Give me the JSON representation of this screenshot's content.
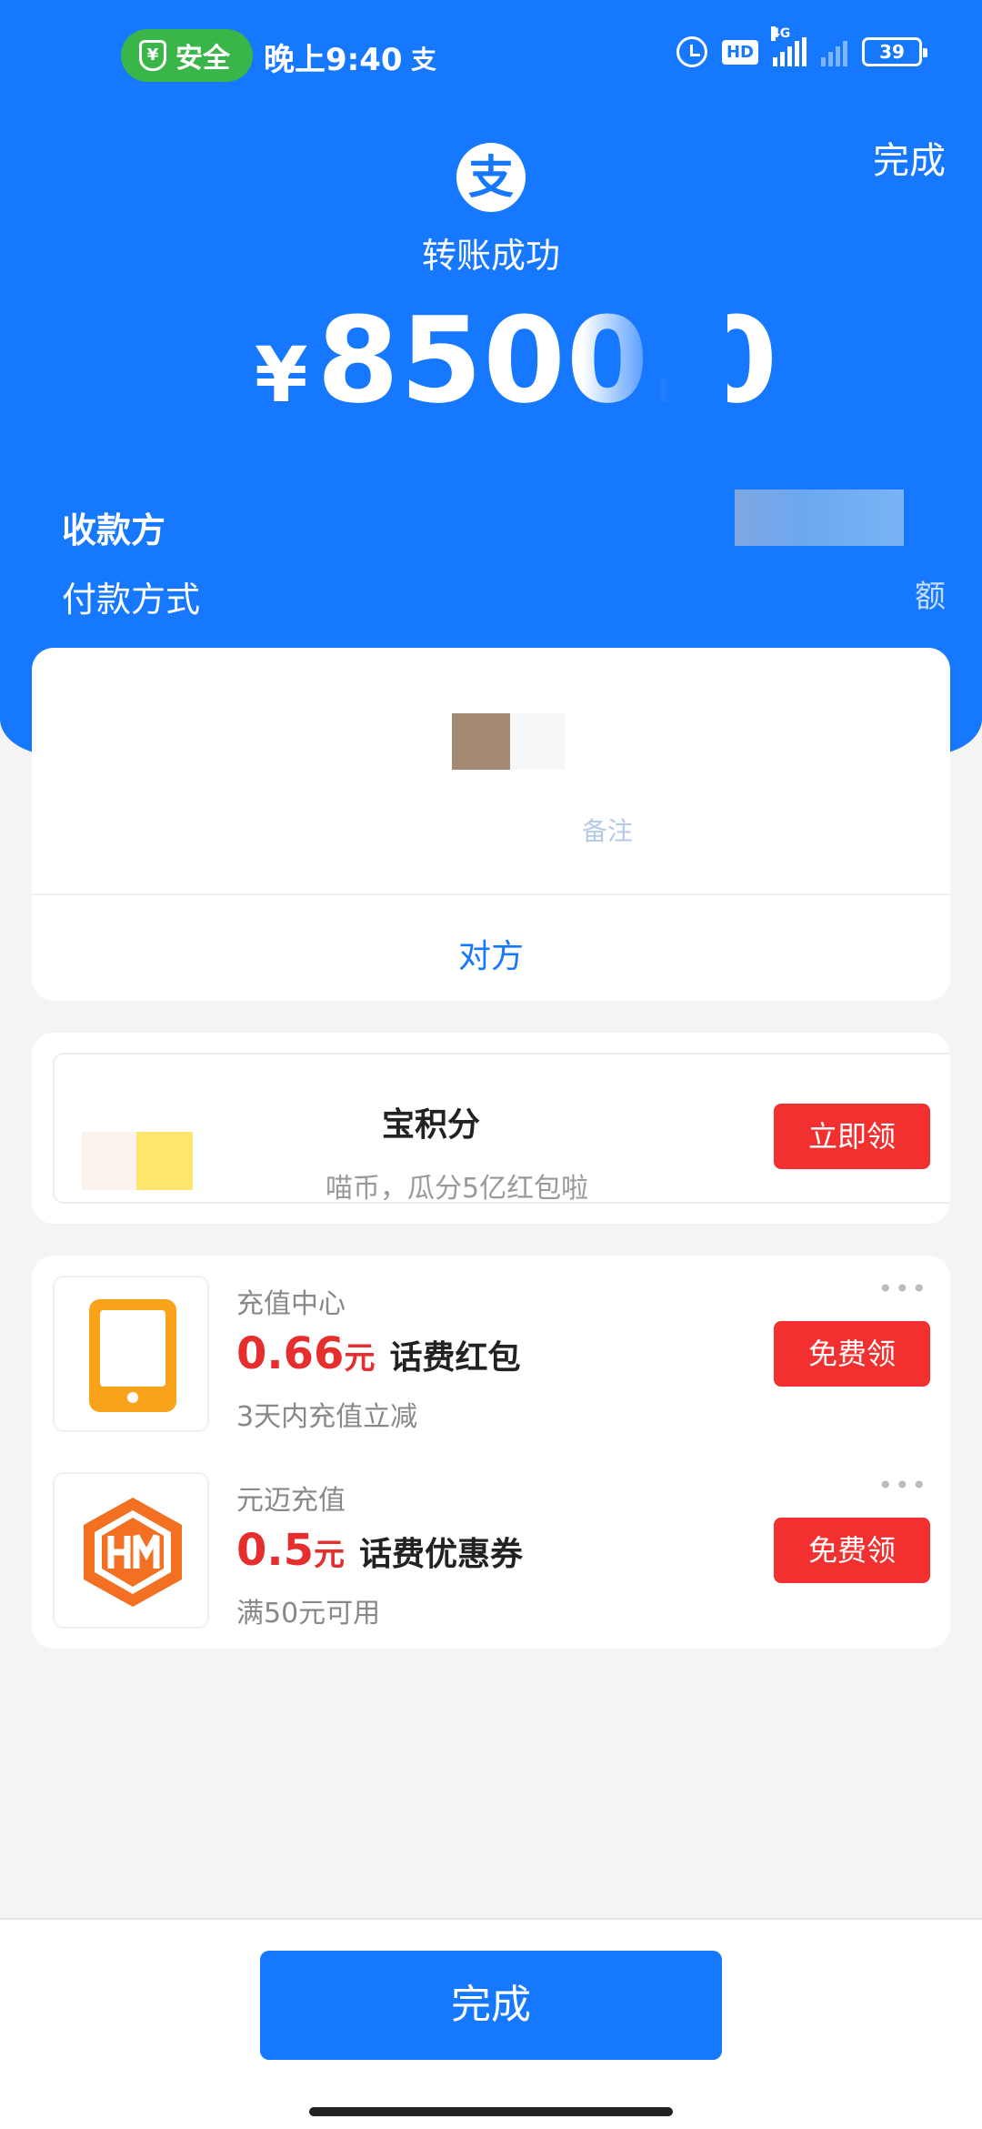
{
  "status_bar": {
    "safety_label": "安全",
    "safety_glyph": "¥",
    "time": "晚上9:40",
    "app_glyph": "支",
    "hd_label": "HD",
    "network_label": "4G",
    "battery": "39"
  },
  "header": {
    "done_label": "完成",
    "logo_glyph": "支",
    "title": "转账成功",
    "currency": "¥",
    "amount": "8500.0"
  },
  "details": {
    "payee_label": "收款方",
    "payment_method_label": "付款方式",
    "payment_method_value_fragment": "额"
  },
  "card1": {
    "note_fragment": "备注",
    "link_fragment": "对方"
  },
  "promo": {
    "title_fragment": "宝积分",
    "subtitle_fragment": "喵币，瓜分5亿红包啦",
    "button_label": "立即领"
  },
  "offers": [
    {
      "icon": "tablet-icon",
      "merchant": "充值中心",
      "price": "0.66",
      "unit": "元",
      "name": "话费红包",
      "desc": "3天内充值立减",
      "button_label": "免费领",
      "more_label": "•••"
    },
    {
      "icon": "ym-hex-icon",
      "merchant": "元迈充值",
      "price": "0.5",
      "unit": "元",
      "name": "话费优惠券",
      "desc": "满50元可用",
      "button_label": "免费领",
      "more_label": "•••"
    }
  ],
  "footer": {
    "done_label": "完成"
  },
  "colors": {
    "brand_blue": "#1677ff",
    "action_red": "#f23030",
    "price_red": "#e62e2e",
    "safe_green": "#3ab54a"
  }
}
